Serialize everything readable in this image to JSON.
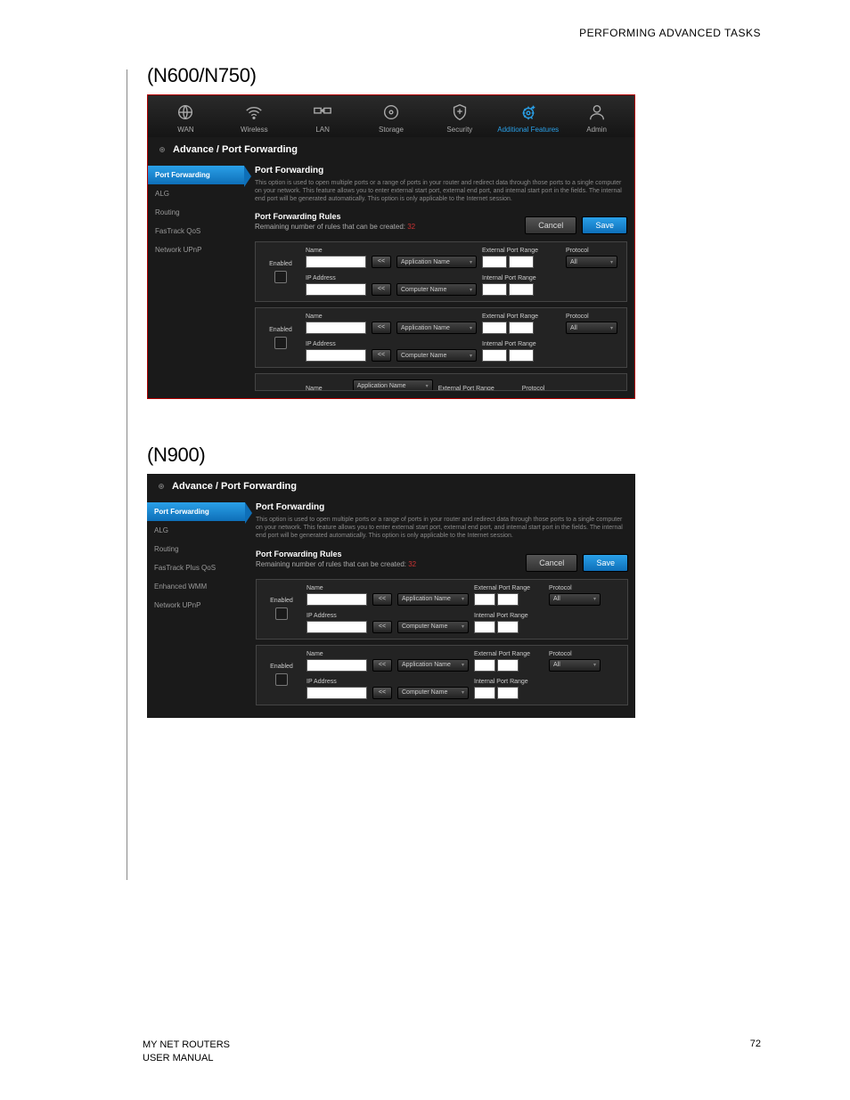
{
  "page_header": "PERFORMING ADVANCED TASKS",
  "section1_title": "(N600/N750)",
  "section2_title": "(N900)",
  "topnav": {
    "items": [
      {
        "label": "WAN"
      },
      {
        "label": "Wireless"
      },
      {
        "label": "LAN"
      },
      {
        "label": "Storage"
      },
      {
        "label": "Security"
      },
      {
        "label": "Additional Features"
      },
      {
        "label": "Admin"
      }
    ]
  },
  "breadcrumb": "Advance / Port Forwarding",
  "sidebar_a": [
    "Port Forwarding",
    "ALG",
    "Routing",
    "FasTrack QoS",
    "Network UPnP"
  ],
  "sidebar_b": [
    "Port Forwarding",
    "ALG",
    "Routing",
    "FasTrack Plus QoS",
    "Enhanced WMM",
    "Network UPnP"
  ],
  "panel": {
    "title": "Port Forwarding",
    "desc": "This option is used to open multiple ports or a range of ports in your router and redirect data through those ports to a single computer on your network. This feature allows you to enter external start port, external end port, and internal start port in the fields. The internal end port will be generated automatically. This option is only applicable to the Internet session.",
    "rules_title": "Port Forwarding Rules",
    "remaining_label": "Remaining number of rules that can be created:",
    "remaining_value": "32",
    "cancel": "Cancel",
    "save": "Save"
  },
  "rule_labels": {
    "enabled": "Enabled",
    "name": "Name",
    "ip": "IP Address",
    "appname": "Application Name",
    "compname": "Computer Name",
    "ext_range": "External Port Range",
    "int_range": "Internal Port Range",
    "protocol": "Protocol",
    "protocol_value": "All",
    "arrow": "<<"
  },
  "footer": {
    "left1": "MY NET ROUTERS",
    "left2": "USER MANUAL",
    "page": "72"
  }
}
